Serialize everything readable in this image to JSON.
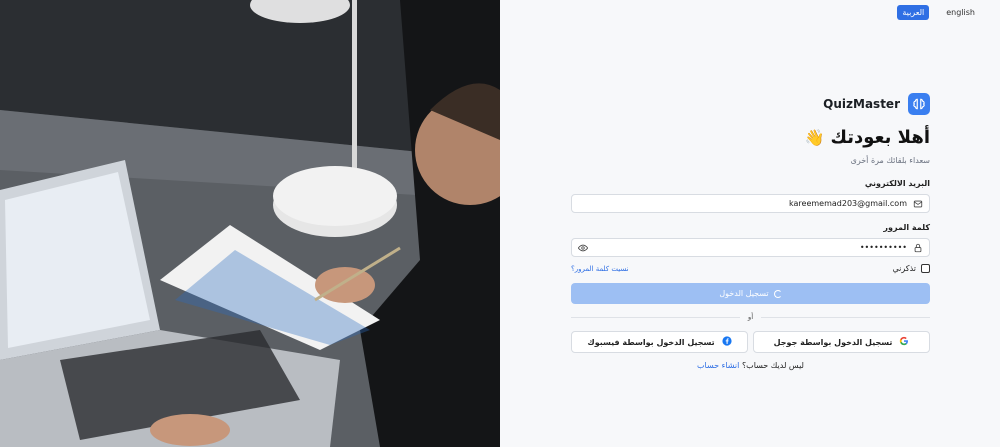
{
  "language": {
    "english_label": "english",
    "arabic_label": "العربية"
  },
  "brand": {
    "name": "QuizMaster"
  },
  "header": {
    "title": "أهلا بعودتك",
    "wave_emoji": "👋",
    "subtitle": "سعداء بلقائك مرة أخرى"
  },
  "form": {
    "email_label": "البريد الالكتروني",
    "email_value": "kareememad203@gmail.com",
    "password_label": "كلمة المرور",
    "password_value": "••••••••••",
    "remember_label": "تذكرني",
    "forgot_label": "نسيت كلمة المرور؟",
    "login_label": "تسجيل الدخول"
  },
  "divider": {
    "or_label": "أو"
  },
  "social": {
    "google_label": "تسجيل الدخول بواسطة جوجل",
    "facebook_label": "تسجيل الدخول بواسطة فيسبوك"
  },
  "signup": {
    "prompt": "ليس لديك حساب؟",
    "link": "انشاء حساب"
  },
  "colors": {
    "primary": "#2f6fe4",
    "login_disabled": "#9dbff3",
    "brand_logo": "#3a7ff0"
  },
  "icons": [
    "brain-icon",
    "mail-icon",
    "lock-icon",
    "eye-icon",
    "google-icon",
    "facebook-icon",
    "spinner-icon"
  ]
}
